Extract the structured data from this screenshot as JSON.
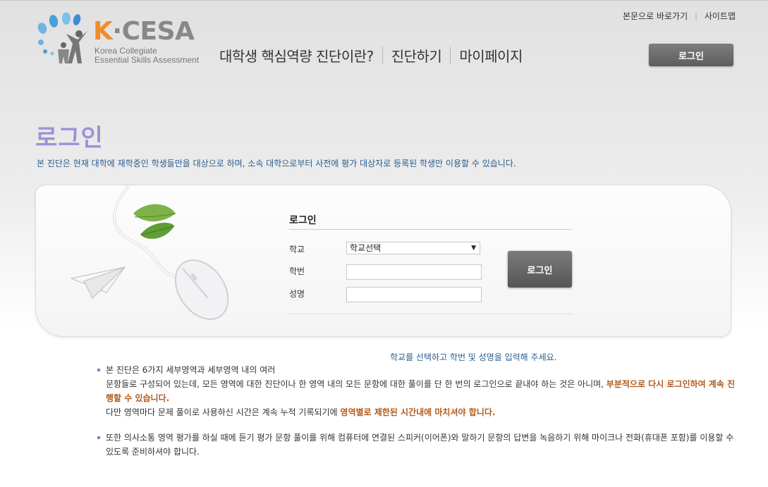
{
  "util_links": {
    "skip_to_content": "본문으로 바로가기",
    "sitemap": "사이트맵",
    "separator": "|"
  },
  "logo": {
    "brand_prefix": "K",
    "brand_dot": "·",
    "brand_name": "CESA",
    "sub_line1": "Korea Collegiate",
    "sub_line2": "Essential Skills Assessment"
  },
  "nav": {
    "item1": "대학생 핵심역량 진단이란?",
    "item2": "진단하기",
    "item3": "마이페이지"
  },
  "header_login_label": "로그인",
  "page": {
    "title": "로그인",
    "intro": "본 진단은 현재 대학에 재학중인 학생들만을 대상으로 하며, 소속 대학으로부터 사전에 평가 대상자로 등록된 학생만 이용할 수 있습니다."
  },
  "login_form": {
    "heading": "로그인",
    "school_label": "학교",
    "school_value": "학교선택",
    "student_id_label": "학번",
    "name_label": "성명",
    "submit_label": "로그인"
  },
  "hint": "학교를 선택하고 학번 및 성명을 입력해 주세요.",
  "notes": {
    "n1_part1": "본 진단은 6가지 세부영역과 세부영역 내의 여러",
    "n1_part2": "문항들로 구성되어 있는데, 모든 영역에 대한 진단이나 한 영역 내의 모든 문항에 대한 풀이를 단 한 번의 로그인으로 끝내야 하는 것은 아니며, ",
    "n1_em1": "부분적으로 다시 로그인하여 계속 진행할 수 있습니다.",
    "n1_part3": "다만 영역마다 문제 풀이로 사용하신 시간은 계속 누적 기록되기에 ",
    "n1_em2": "영역별로 제한된 시간내에 마치셔야 합니다.",
    "n2": "또한 의사소통 영역 평가를 하실 때에 듣기 평가 문항 풀이를 위해 컴퓨터에 연결된 스피커(이어폰)와 말하기 문항의 답변을 녹음하기 위해 마이크나 전화(휴대폰 포함)를 이용할 수 있도록 준비하셔야 합니다."
  },
  "icons": {
    "logo_mark": "people-figures-icon",
    "select_arrow": "caret-down-icon",
    "illustration": "mouse-leaf-paper-plane-illustration"
  },
  "colors": {
    "title": "#9a93d8",
    "info_text": "#2a5d8f",
    "emphasis": "#b25a1c",
    "brand_orange": "#f28c28"
  }
}
